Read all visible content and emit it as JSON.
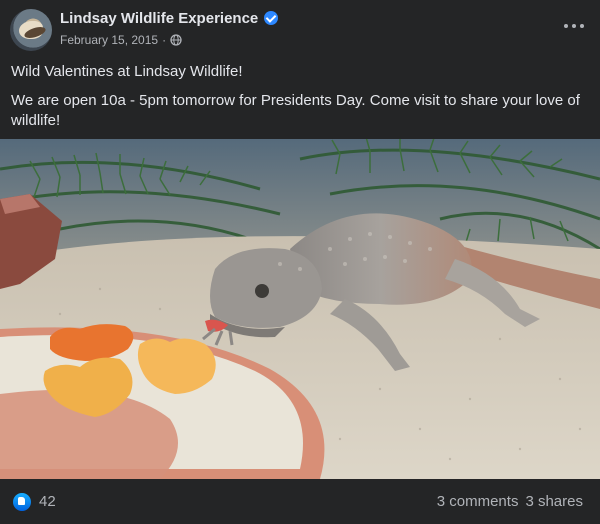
{
  "post": {
    "page_name": "Lindsay Wildlife Experience",
    "date": "February 15, 2015",
    "separator": "·",
    "verified": true,
    "text_line1": "Wild Valentines at Lindsay Wildlife!",
    "text_line2": "We are open 10a - 5pm tomorrow for Presidents Day. Come visit to share your love of wildlife!"
  },
  "photo": {
    "subject": "desert lizard eating heart-shaped fruit pieces"
  },
  "reactions": {
    "like_count": "42",
    "comments": "3 comments",
    "shares": "3 shares"
  },
  "icons": {
    "verified": "verified-badge-icon",
    "audience": "globe-icon",
    "more": "more-options-icon",
    "like": "like-reaction-icon"
  },
  "colors": {
    "background": "#242526",
    "text_primary": "#e4e6eb",
    "text_secondary": "#b0b3b8",
    "accent": "#2d88ff"
  }
}
